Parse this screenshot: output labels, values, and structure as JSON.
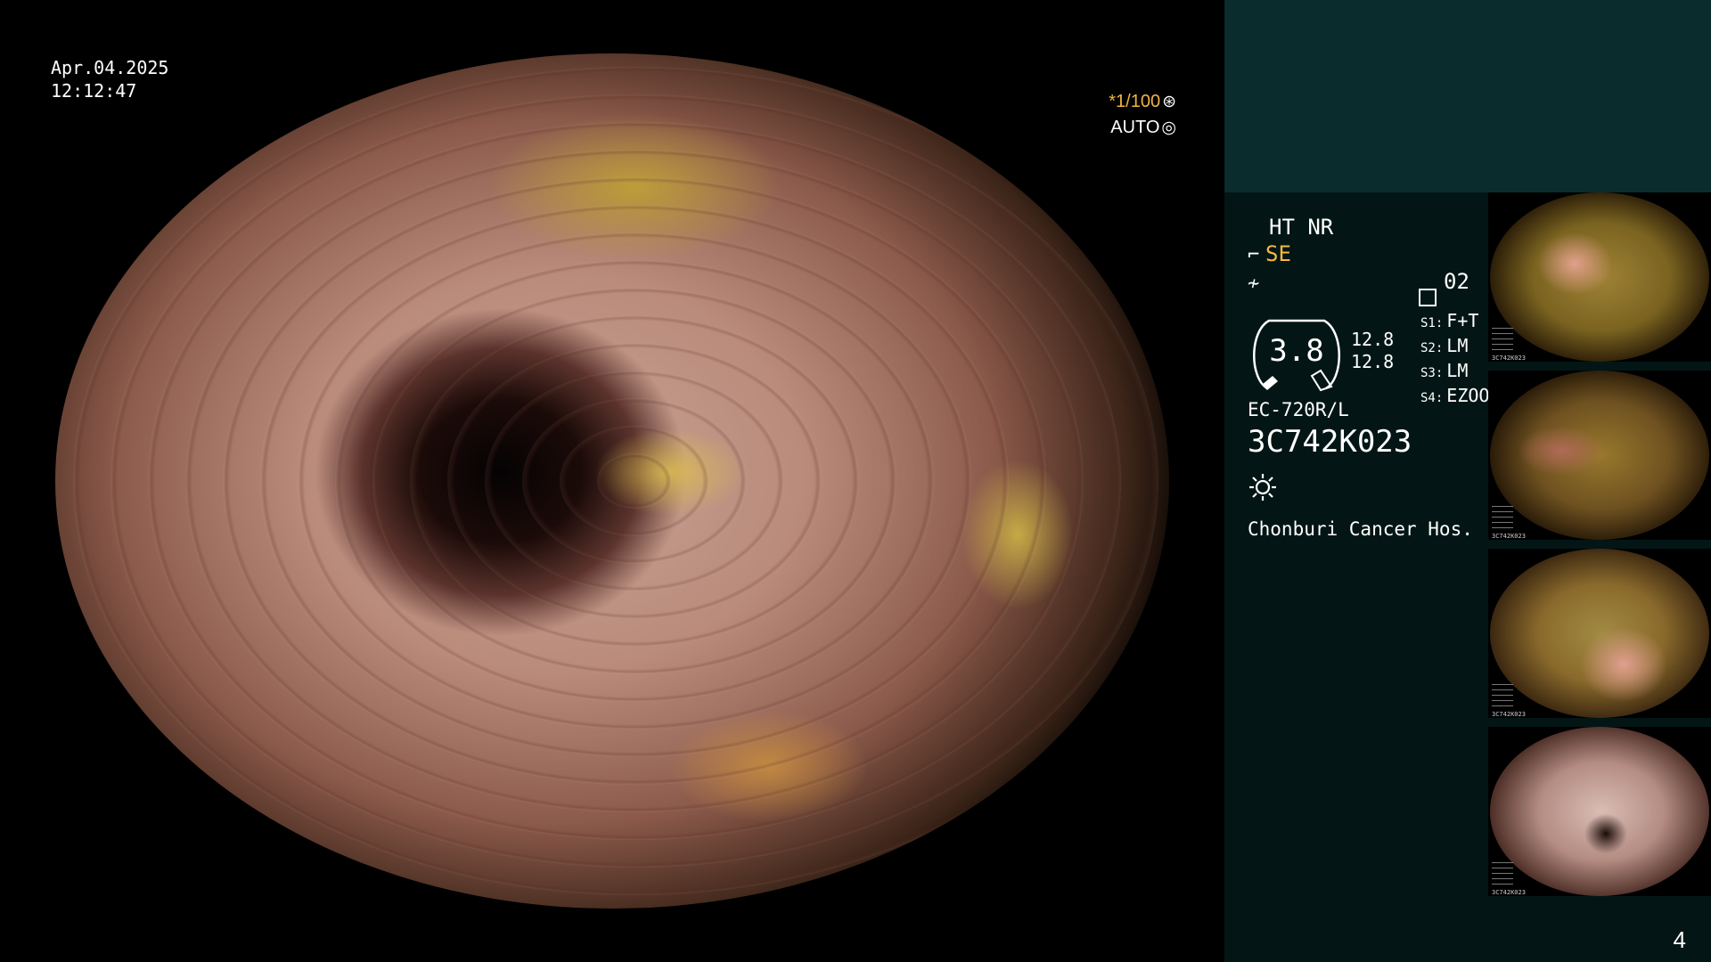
{
  "header": {
    "date": "Apr.04.2025",
    "time": "12:12:47"
  },
  "camera": {
    "shutter_speed": "*1/100",
    "shutter_icon": "aperture-icon",
    "iris_mode": "AUTO",
    "iris_icon": "iris-icon"
  },
  "panel": {
    "mode_top": "HT NR",
    "mode_label": "SE",
    "memory_label": "02",
    "zoom_value": "3.8",
    "ratio_1": "12.8",
    "ratio_2": "12.8",
    "switches": [
      {
        "key": "S1:",
        "value": "F+T"
      },
      {
        "key": "S2:",
        "value": "LM"
      },
      {
        "key": "S3:",
        "value": "LM"
      },
      {
        "key": "S4:",
        "value": "EZOOM"
      }
    ],
    "scope_model": "EC-720R/L",
    "scope_serial": "3C742K023",
    "light_icon": "light-bulb-icon",
    "hospital": "Chonburi Cancer Hos."
  },
  "thumbnails": [
    {
      "serial": "3C742K023"
    },
    {
      "serial": "3C742K023"
    },
    {
      "serial": "3C742K023"
    },
    {
      "serial": "3C742K023"
    }
  ],
  "page_number": "4",
  "colors": {
    "accent_orange": "#f4b840",
    "panel_bg": "#031615",
    "panel_top": "#0b2c2c"
  }
}
